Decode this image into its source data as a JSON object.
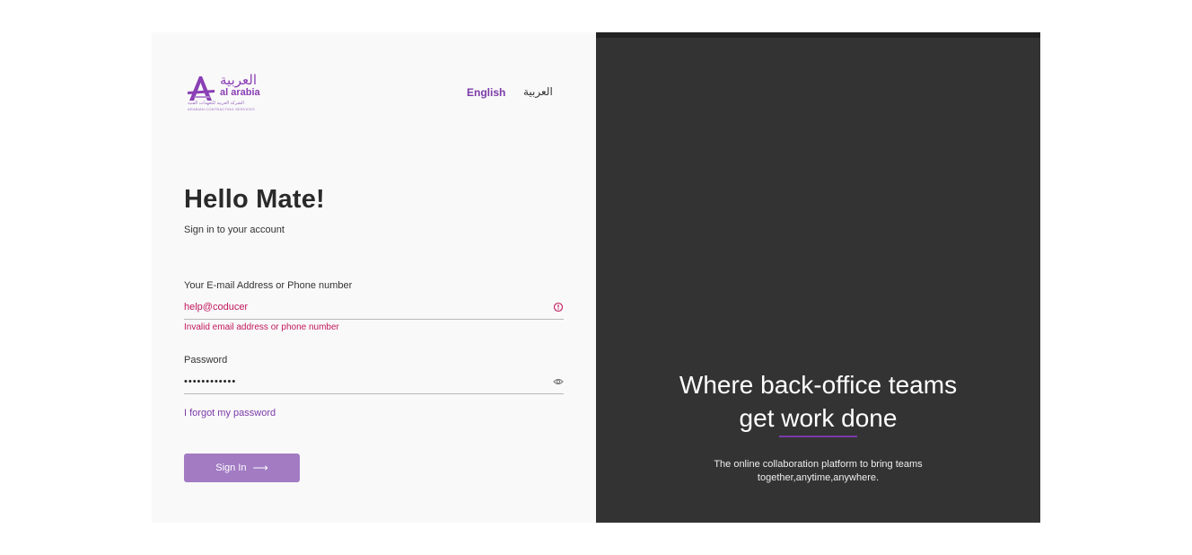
{
  "logo": {
    "arabic": "العربية",
    "latin": "al arabia",
    "sub_arabic": "الشركة العربية للتعهدات الفنية",
    "sub_latin": "ARABIAN CONTRACTING SERVICES"
  },
  "lang": {
    "english": "English",
    "arabic": "العربية"
  },
  "login": {
    "title": "Hello Mate!",
    "subtitle": "Sign in to your account",
    "email_label": "Your E-mail Address or Phone number",
    "email_value": "help@coducer",
    "email_error": "Invalid email address or phone number",
    "password_label": "Password",
    "password_value": "••••••••••••",
    "forgot": "I forgot my password",
    "signin": "Sign In",
    "signin_arrow": "⟶"
  },
  "hero": {
    "line1": "Where back-office teams",
    "line2": "get work done",
    "sub1": "The online collaboration platform to bring teams",
    "sub2": "together,anytime,anywhere."
  },
  "colors": {
    "accent": "#7b3aa8",
    "button": "#a27bc3",
    "error": "#c2185b",
    "panel_dark": "#333333"
  }
}
